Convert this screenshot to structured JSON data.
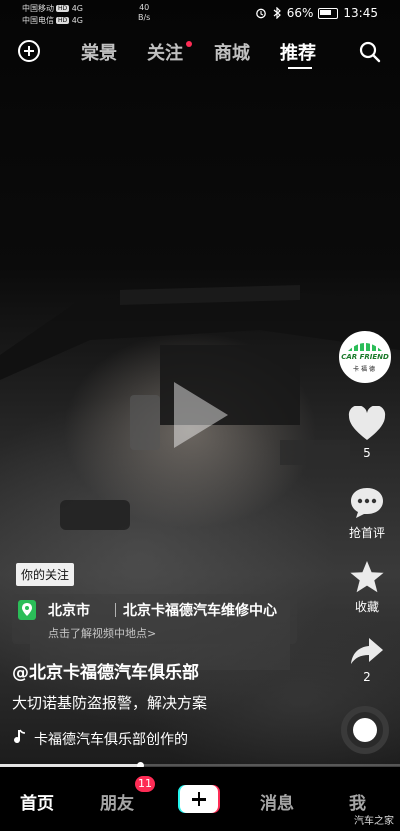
{
  "status_bar": {
    "carrier_1": "中国移动",
    "carrier_2": "中国电信",
    "hd_label": "HD",
    "network_1": "4G",
    "network_2": "4G",
    "net_speed_value": "40",
    "net_speed_unit": "B/s",
    "battery": "66%",
    "time": "13:45"
  },
  "top_nav": {
    "tabs": [
      "棠景",
      "关注",
      "商城",
      "推荐"
    ],
    "active_tab": "推荐",
    "follow_has_dot": true
  },
  "right_rail": {
    "avatar_title": "CAR FRIEND",
    "avatar_sub": "卡福德",
    "like_count": "5",
    "comment_label": "抢首评",
    "favorite_label": "收藏",
    "share_count": "2"
  },
  "caption": {
    "follow_tag": "你的关注",
    "poi_city": "北京市",
    "poi_name": "北京卡福德汽车维修中心",
    "poi_hint": "点击了解视频中地点>",
    "author": "@北京卡福德汽车俱乐部",
    "description": "大切诺基防盗报警，解决方案",
    "music": "卡福德汽车俱乐部创作的"
  },
  "progress": {
    "value": 0.35
  },
  "bottom_nav": {
    "home": "首页",
    "friends": "朋友",
    "friends_badge": "11",
    "inbox": "消息",
    "me": "我"
  },
  "watermark": "汽车之家",
  "colors": {
    "accent_red": "#fe2c55",
    "accent_cyan": "#25f4ee",
    "poi_green": "#2bbd58"
  },
  "icons": [
    "plus-circle-icon",
    "search-icon",
    "play-icon",
    "heart-icon",
    "comment-icon",
    "star-icon",
    "share-icon",
    "location-pin-icon",
    "music-note-icon",
    "music-disc-icon",
    "create-plus-icon"
  ]
}
